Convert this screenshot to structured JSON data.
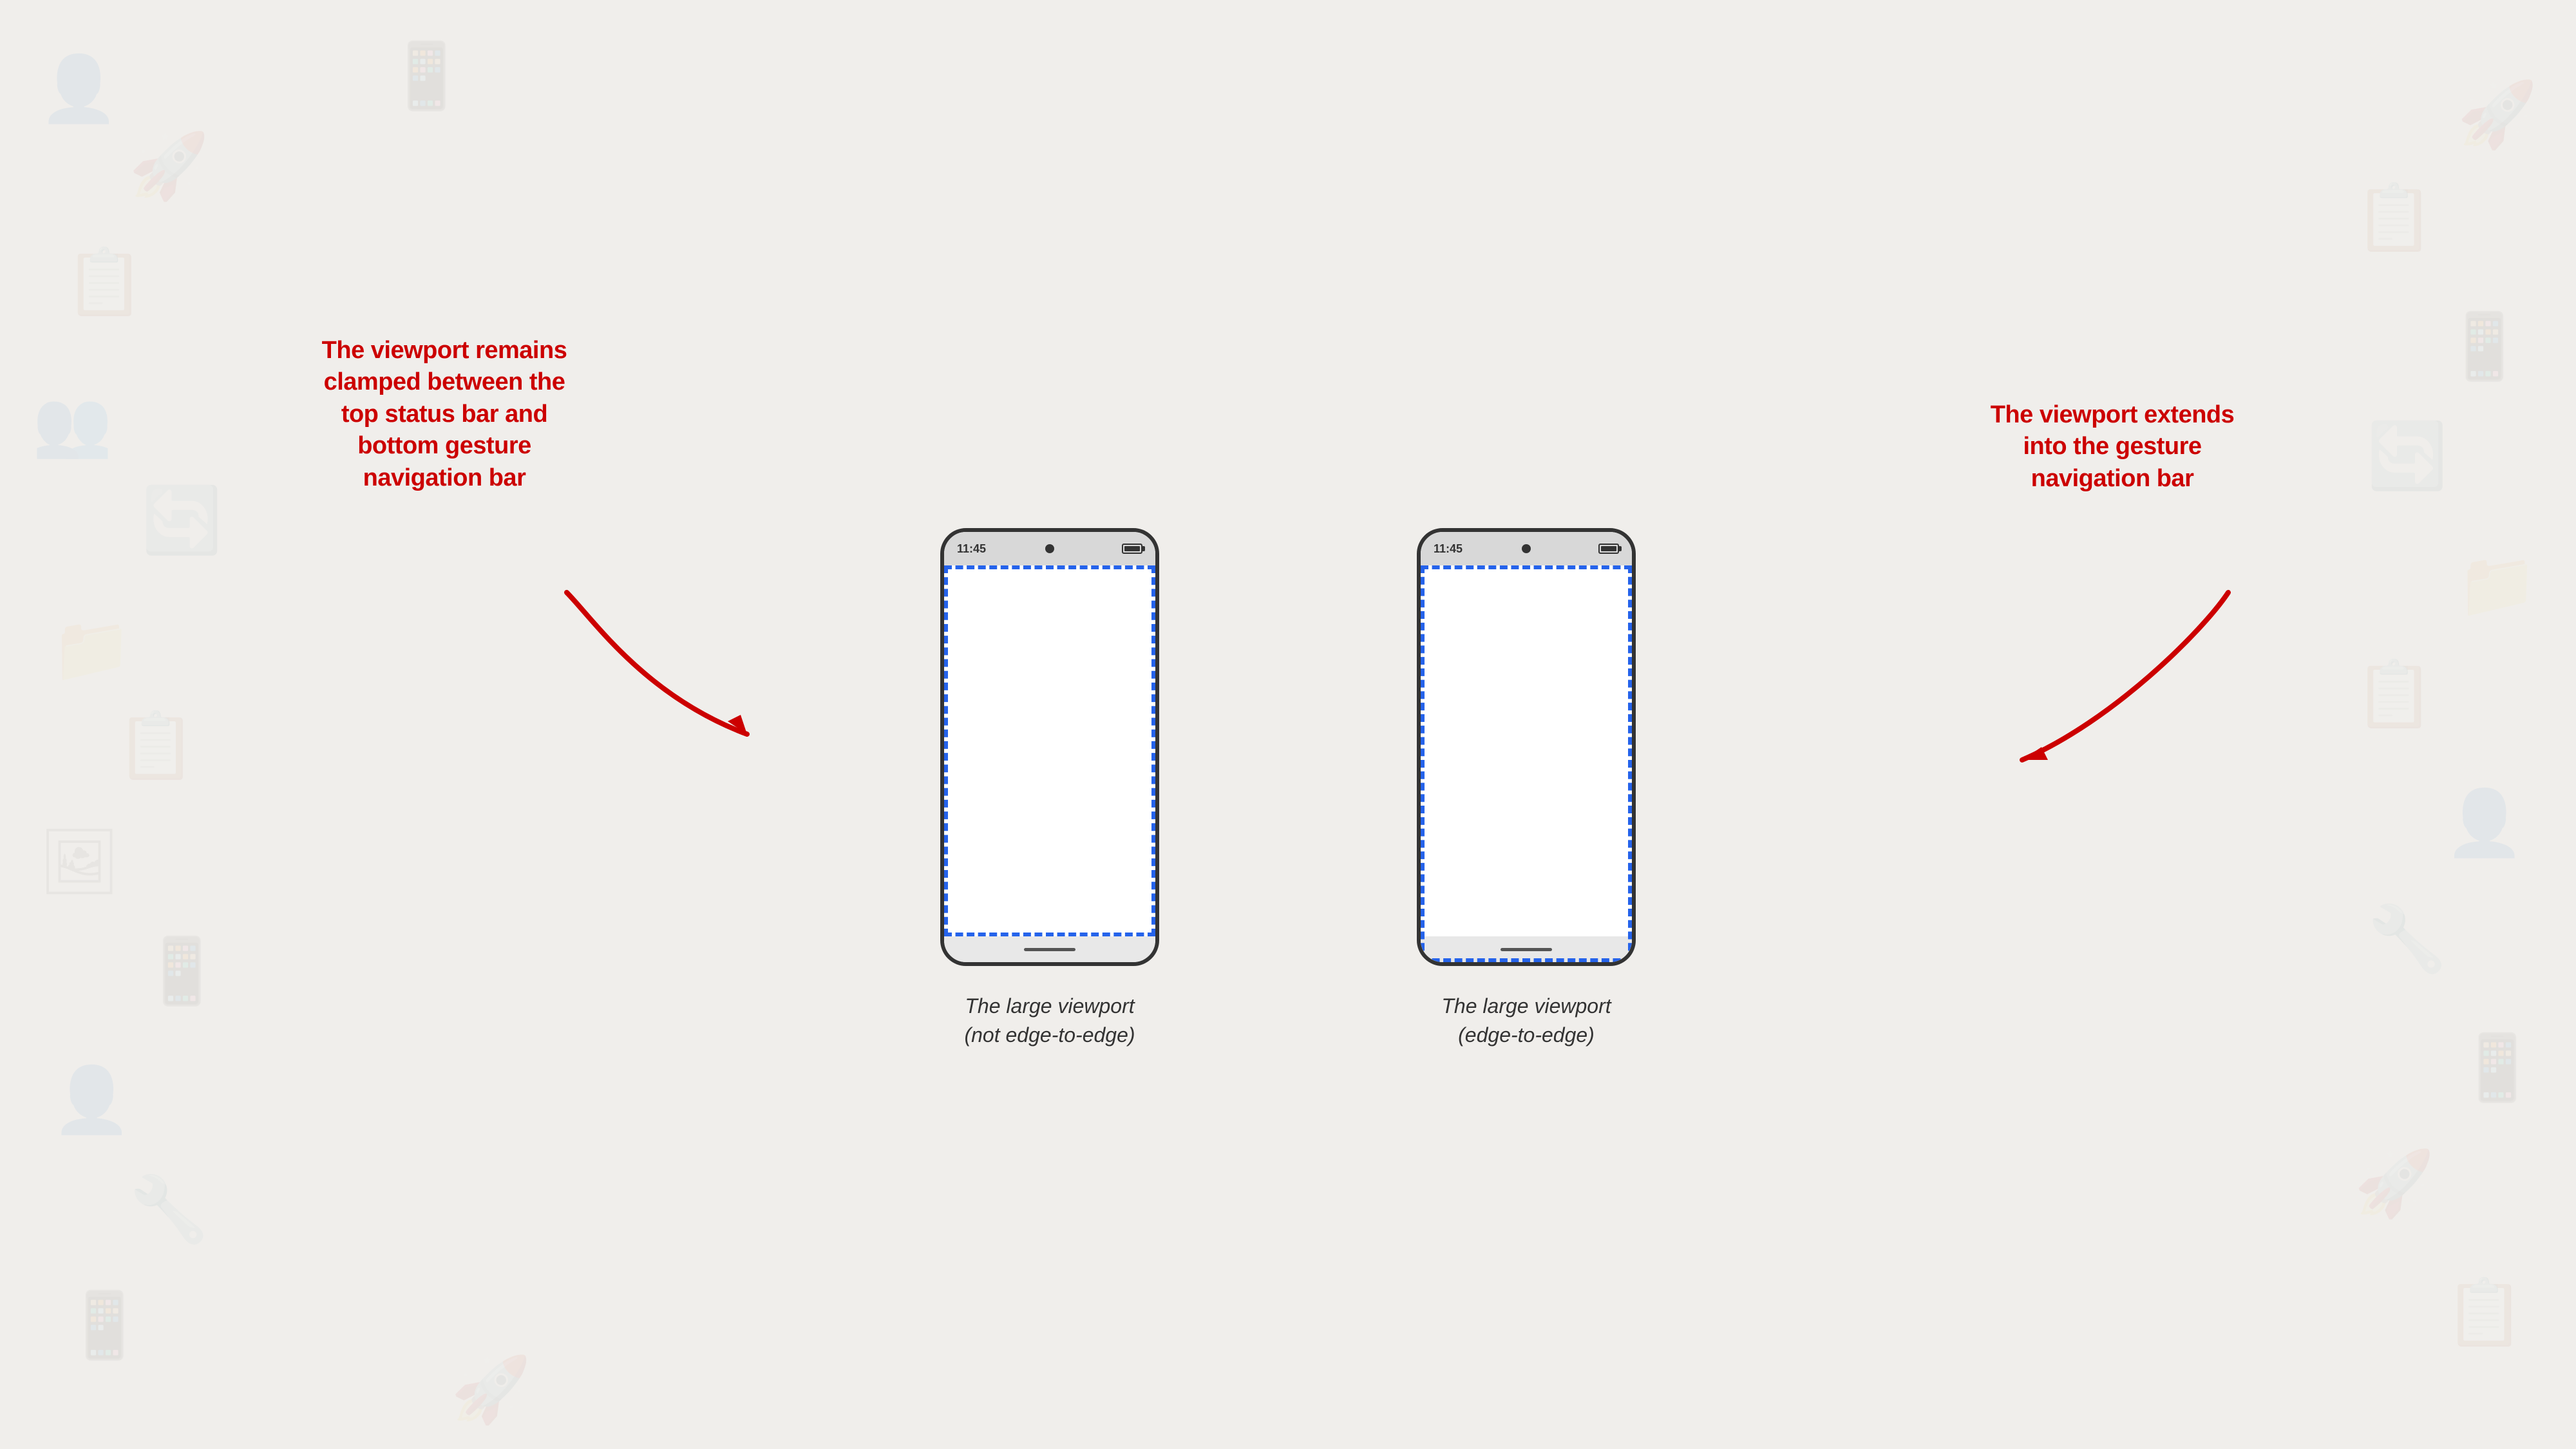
{
  "background": {
    "color": "#f0eeeb"
  },
  "phones": {
    "left": {
      "status_time": "11:45",
      "caption_line1": "The large viewport",
      "caption_line2": "(not edge-to-edge)",
      "viewport_type": "clamped",
      "label": "phone-left"
    },
    "right": {
      "status_time": "11:45",
      "caption_line1": "The large viewport",
      "caption_line2": "(edge-to-edge)",
      "viewport_type": "edge-to-edge",
      "label": "phone-right"
    }
  },
  "annotations": {
    "left": {
      "text": "The viewport remains clamped between the top status bar and bottom gesture navigation bar"
    },
    "right": {
      "text": "The viewport extends into the gesture navigation bar"
    }
  },
  "colors": {
    "annotation_red": "#cc0000",
    "border_blue": "#2563eb",
    "phone_border": "#333333",
    "status_bar_bg": "#d8d8d8",
    "bottom_bar_bg": "#e8e8e8"
  }
}
